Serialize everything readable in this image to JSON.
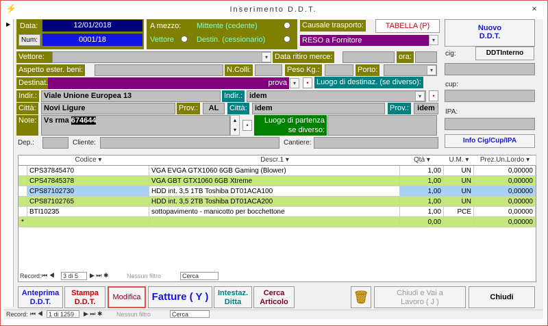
{
  "window": {
    "title": "Inserimento  D.D.T.",
    "close": "×"
  },
  "header": {
    "data_label": "Data:",
    "data_value": "12/01/2018",
    "num_label": "Num:",
    "num_value": "0001/18",
    "amezzo_label": "A mezzo:",
    "mittente_label": "Mittente    (cedente)",
    "vettore_label": "Vettore",
    "destin_label": "Destin.  (cessionario)",
    "causale_label": "Causale trasporto:",
    "tabella_button": "TABELLA (P)",
    "causale_value": "RESO a Fornitore",
    "nuovo_button_line1": "Nuovo",
    "nuovo_button_line2": "D.D.T."
  },
  "fields": {
    "vettore_label": "Vettore:",
    "data_ritiro_label": "Data ritiro merce:",
    "ora_label": "ora:",
    "aspetto_label": "Aspetto ester. beni:",
    "ncolli_label": "N.Colli:",
    "peso_label": "Peso Kg.:",
    "porto_label": "Porto:",
    "destinat_label": "Destinat.:",
    "destinat_value": "prova",
    "luogo_dest_label": "Luogo di destinaz. (se diverso):",
    "indir_label": "Indir.:",
    "indir_value": "Viale Unione Europea   13",
    "indir2_label": "Indir.:",
    "indir2_value": "idem",
    "citta_label": "Città:",
    "citta_value": "Novi Ligure",
    "prov_label": "Prov.:",
    "prov_value": "AL",
    "citta2_label": "Città:",
    "citta2_value": "idem",
    "prov2_label": "Prov.:",
    "prov2_value": "idem",
    "note_label": "Note:",
    "note_prefix": "Vs rma",
    "note_highlight": "674644",
    "luogo_partenza_line1": "Luogo di partenza",
    "luogo_partenza_line2": "se diverso:",
    "dep_label": "Dep.:",
    "cliente_label": "Cliente:",
    "cantiere_label": "Cantiere:"
  },
  "sidepanel": {
    "cig_label": "cig:",
    "ddtinterno_button": "DDTInterno",
    "cup_label": "cup:",
    "ipa_label": "IPA:",
    "infocig_button": "Info Cig/Cup/IPA"
  },
  "grid": {
    "headers": [
      "Codice",
      "Descr.1",
      "Qtà",
      "U.M.",
      "Prez.Un.Lordo"
    ],
    "rows": [
      {
        "codice": "CPS37845470",
        "descr": "VGA EVGA GTX1060 6GB Gaming (Blower)",
        "qta": "1,00",
        "um": "UN",
        "prezzo": "0,00000"
      },
      {
        "codice": "CPS47845378",
        "descr": "VGA GBT GTX1060 6GB Xtreme",
        "qta": "1,00",
        "um": "UN",
        "prezzo": "0,00000"
      },
      {
        "codice": "CPS87102730",
        "descr": "HDD int. 3,5 1TB Toshiba DT01ACA100",
        "qta": "1,00",
        "um": "UN",
        "prezzo": "0,00000"
      },
      {
        "codice": "CPS87102765",
        "descr": "HDD int. 3,5 2TB Toshiba DT01ACA200",
        "qta": "1,00",
        "um": "UN",
        "prezzo": "0,00000"
      },
      {
        "codice": "BTI10235",
        "descr": "sottopavimento - manicotto per bocchettone",
        "qta": "1,00",
        "um": "PCE",
        "prezzo": "0,00000"
      }
    ],
    "new_row": {
      "marker": "*",
      "qta": "0,00",
      "prezzo": "0,00000"
    },
    "nav_record": "Record:",
    "nav_pos": "3 di 5",
    "nav_filter": "Nessun filtro",
    "nav_search": "Cerca"
  },
  "buttons": {
    "anteprima1": "Anteprima",
    "anteprima2": "D.D.T.",
    "stampa1": "Stampa",
    "stampa2": "D.D.T.",
    "modifica": "Modifica",
    "fatture": "Fatture ( Y )",
    "intestaz1": "Intestaz.",
    "intestaz2": "Ditta",
    "cerca1": "Cerca",
    "cerca2": "Articolo",
    "chiudivai1": "Chiudi e Vai a",
    "chiudivai2": "Lavoro ( J )",
    "chiudi": "Chiudi"
  },
  "statusbar": {
    "record": "Record:",
    "pos": "1 di 1259",
    "filter": "Nessun filtro",
    "search": "Cerca"
  },
  "colors": {
    "olive": "#808000",
    "teal": "#008080",
    "purple": "#800080",
    "blue": "#1414e6",
    "navy": "#00007f",
    "green_row": "#c5e77e",
    "selected_row": "#a9d0f5"
  }
}
